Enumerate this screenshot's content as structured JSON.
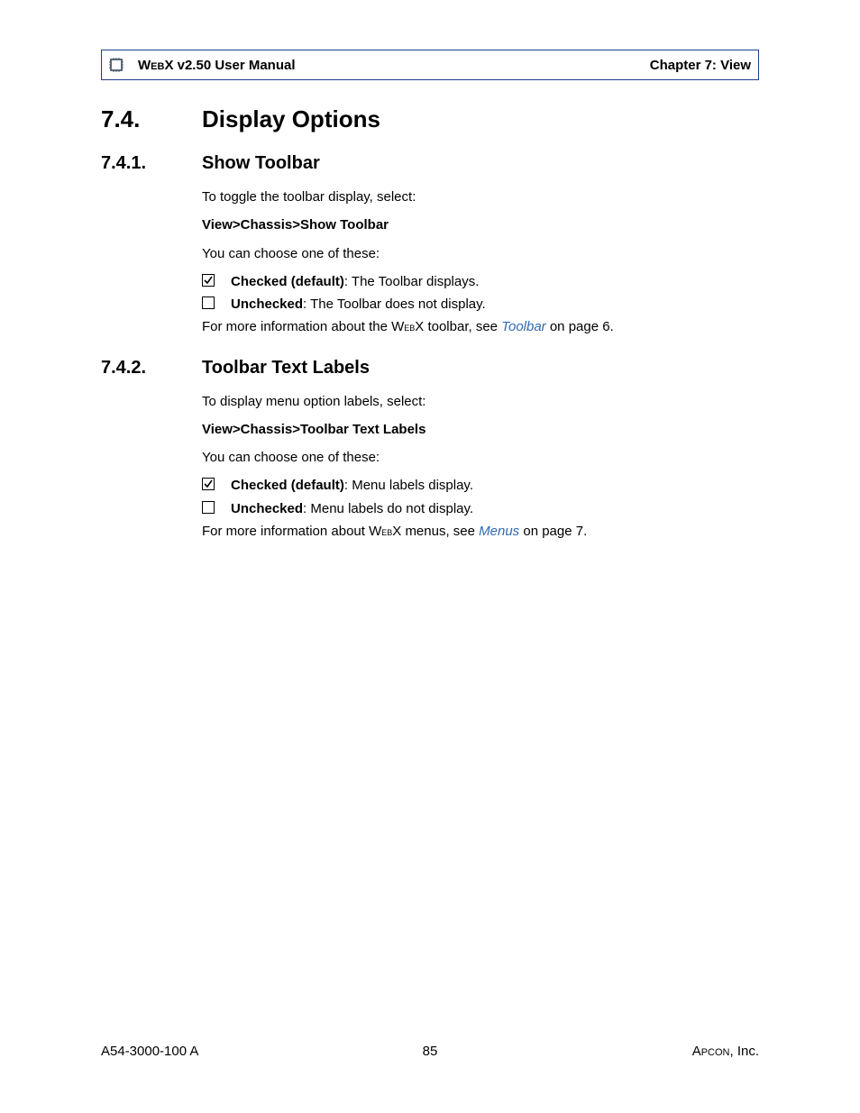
{
  "header": {
    "product_sc": "WebX",
    "product_rest": " v2.50 User Manual",
    "chapter": "Chapter 7: View"
  },
  "h1": {
    "num": "7.4.",
    "title": "Display Options"
  },
  "sec1": {
    "num": "7.4.1.",
    "title": "Show Toolbar",
    "intro": "To toggle the toolbar display, select:",
    "path": "View>Chassis>Show Toolbar",
    "choose": "You can choose one of these:",
    "checked_bold": "Checked (default)",
    "checked_rest": ": The Toolbar displays.",
    "unchecked_bold": "Unchecked",
    "unchecked_rest": ": The Toolbar does not display.",
    "more_pre_sc": "For more information about the W",
    "more_sc": "eb",
    "more_post_sc": "X toolbar, see ",
    "more_link": "Toolbar",
    "more_tail": " on page 6."
  },
  "sec2": {
    "num": "7.4.2.",
    "title": "Toolbar Text Labels",
    "intro": "To display menu option labels, select:",
    "path": "View>Chassis>Toolbar Text Labels",
    "choose": "You can choose one of these:",
    "checked_bold": "Checked (default)",
    "checked_rest": ": Menu labels display.",
    "unchecked_bold": "Unchecked",
    "unchecked_rest": ": Menu labels do not display.",
    "more_pre_sc": "For more information about W",
    "more_sc": "eb",
    "more_post_sc": "X menus, see ",
    "more_link": "Menus",
    "more_tail": " on page 7."
  },
  "footer": {
    "left": "A54-3000-100 A",
    "page": "85",
    "company_sc": "Apcon",
    "company_rest": ", Inc."
  }
}
